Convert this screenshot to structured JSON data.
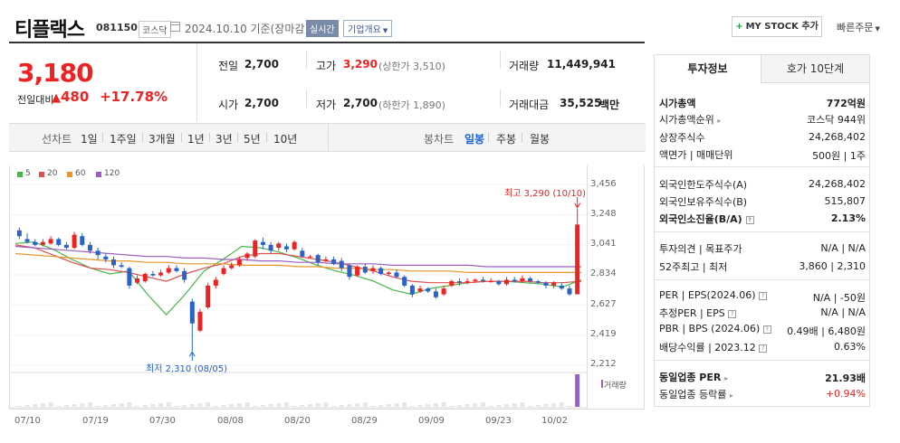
{
  "header": {
    "company_name": "티플랙스",
    "stock_code": "081150",
    "market": "코스닥",
    "date_text": "2024.10.10 기준(장마감)",
    "realtime_label": "실시간",
    "company_overview_label": "기업개요",
    "mystock_label": "MY STOCK 추가",
    "quick_order_label": "빠른주문"
  },
  "price": {
    "current": "3,180",
    "prev_label": "전일대비",
    "change": "480",
    "change_rate": "+17.78%"
  },
  "quote": {
    "prev_close_label": "전일",
    "prev_close": "2,700",
    "high_label": "고가",
    "high": "3,290",
    "upper_limit": "(상한가 3,510)",
    "volume_label": "거래량",
    "volume": "11,449,941",
    "open_label": "시가",
    "open": "2,700",
    "low_label": "저가",
    "low": "2,700",
    "lower_limit": "(하한가 1,890)",
    "amount_label": "거래대금",
    "amount": "35,525",
    "amount_unit": "백만"
  },
  "period_bar": {
    "line_chart_label": "선차트",
    "line_periods": [
      "1일",
      "1주일",
      "3개월",
      "1년",
      "3년",
      "5년",
      "10년"
    ],
    "candle_label": "봉차트",
    "candle_periods": [
      "일봉",
      "주봉",
      "월봉"
    ],
    "active_candle": "일봉"
  },
  "chart_data": {
    "type": "candlestick",
    "legend": [
      {
        "name": "5",
        "color": "#44b744"
      },
      {
        "name": "20",
        "color": "#e05050"
      },
      {
        "name": "60",
        "color": "#e8962a"
      },
      {
        "name": "120",
        "color": "#9a5fc2"
      }
    ],
    "yticks": [
      "3,456",
      "3,248",
      "3,041",
      "2,834",
      "2,627",
      "2,419",
      "2,212"
    ],
    "ylim": [
      2212,
      3456
    ],
    "xticks": [
      "07/10",
      "07/19",
      "07/30",
      "08/08",
      "08/20",
      "08/29",
      "09/09",
      "09/23",
      "10/02"
    ],
    "max_label": "최고 3,290 (10/10)",
    "min_label": "최저 2,310 (08/05)",
    "volume_label": "거래량",
    "candles": [
      {
        "o": 3140,
        "c": 3100,
        "h": 3160,
        "l": 3080
      },
      {
        "o": 3080,
        "c": 3060,
        "h": 3120,
        "l": 3050
      },
      {
        "o": 3060,
        "c": 3040,
        "h": 3080,
        "l": 3030
      },
      {
        "o": 3040,
        "c": 3060,
        "h": 3080,
        "l": 3030
      },
      {
        "o": 3050,
        "c": 3080,
        "h": 3100,
        "l": 3040
      },
      {
        "o": 3080,
        "c": 3040,
        "h": 3090,
        "l": 3030
      },
      {
        "o": 3040,
        "c": 3020,
        "h": 3060,
        "l": 3010
      },
      {
        "o": 3020,
        "c": 3110,
        "h": 3130,
        "l": 3010
      },
      {
        "o": 3100,
        "c": 3040,
        "h": 3120,
        "l": 3030
      },
      {
        "o": 3040,
        "c": 3000,
        "h": 3060,
        "l": 2980
      },
      {
        "o": 3000,
        "c": 2970,
        "h": 3020,
        "l": 2940
      },
      {
        "o": 2960,
        "c": 2940,
        "h": 2980,
        "l": 2920
      },
      {
        "o": 2940,
        "c": 2900,
        "h": 2960,
        "l": 2880
      },
      {
        "o": 2900,
        "c": 2890,
        "h": 2920,
        "l": 2880
      },
      {
        "o": 2880,
        "c": 2760,
        "h": 2890,
        "l": 2740
      },
      {
        "o": 2780,
        "c": 2810,
        "h": 2830,
        "l": 2770
      },
      {
        "o": 2790,
        "c": 2840,
        "h": 2850,
        "l": 2780
      },
      {
        "o": 2840,
        "c": 2830,
        "h": 2860,
        "l": 2820
      },
      {
        "o": 2830,
        "c": 2850,
        "h": 2870,
        "l": 2820
      },
      {
        "o": 2850,
        "c": 2880,
        "h": 2900,
        "l": 2840
      },
      {
        "o": 2880,
        "c": 2860,
        "h": 2900,
        "l": 2850
      },
      {
        "o": 2860,
        "c": 2800,
        "h": 2880,
        "l": 2780
      },
      {
        "o": 2650,
        "c": 2500,
        "h": 2670,
        "l": 2310
      },
      {
        "o": 2450,
        "c": 2580,
        "h": 2600,
        "l": 2440
      },
      {
        "o": 2610,
        "c": 2760,
        "h": 2780,
        "l": 2600
      },
      {
        "o": 2760,
        "c": 2800,
        "h": 2820,
        "l": 2740
      },
      {
        "o": 2840,
        "c": 2880,
        "h": 2900,
        "l": 2830
      },
      {
        "o": 2880,
        "c": 2900,
        "h": 2920,
        "l": 2870
      },
      {
        "o": 2900,
        "c": 2940,
        "h": 2960,
        "l": 2890
      },
      {
        "o": 2950,
        "c": 2980,
        "h": 2990,
        "l": 2930
      },
      {
        "o": 2960,
        "c": 3070,
        "h": 3080,
        "l": 2950
      },
      {
        "o": 3060,
        "c": 3040,
        "h": 3090,
        "l": 3010
      },
      {
        "o": 3040,
        "c": 3000,
        "h": 3060,
        "l": 2980
      },
      {
        "o": 3020,
        "c": 3050,
        "h": 3060,
        "l": 3000
      },
      {
        "o": 3030,
        "c": 3010,
        "h": 3050,
        "l": 2990
      },
      {
        "o": 3010,
        "c": 3060,
        "h": 3070,
        "l": 3000
      },
      {
        "o": 3000,
        "c": 2960,
        "h": 3020,
        "l": 2950
      },
      {
        "o": 2960,
        "c": 2960,
        "h": 2970,
        "l": 2950
      },
      {
        "o": 2970,
        "c": 2920,
        "h": 2980,
        "l": 2900
      },
      {
        "o": 2930,
        "c": 2940,
        "h": 2960,
        "l": 2920
      },
      {
        "o": 2940,
        "c": 2910,
        "h": 2960,
        "l": 2900
      },
      {
        "o": 2930,
        "c": 2880,
        "h": 2950,
        "l": 2860
      },
      {
        "o": 2900,
        "c": 2820,
        "h": 2910,
        "l": 2800
      },
      {
        "o": 2830,
        "c": 2890,
        "h": 2900,
        "l": 2820
      },
      {
        "o": 2890,
        "c": 2850,
        "h": 2910,
        "l": 2840
      },
      {
        "o": 2860,
        "c": 2880,
        "h": 2900,
        "l": 2840
      },
      {
        "o": 2880,
        "c": 2840,
        "h": 2890,
        "l": 2830
      },
      {
        "o": 2840,
        "c": 2850,
        "h": 2860,
        "l": 2830
      },
      {
        "o": 2850,
        "c": 2820,
        "h": 2870,
        "l": 2810
      },
      {
        "o": 2820,
        "c": 2760,
        "h": 2830,
        "l": 2750
      },
      {
        "o": 2760,
        "c": 2700,
        "h": 2770,
        "l": 2680
      },
      {
        "o": 2720,
        "c": 2740,
        "h": 2760,
        "l": 2710
      },
      {
        "o": 2740,
        "c": 2720,
        "h": 2750,
        "l": 2710
      },
      {
        "o": 2720,
        "c": 2680,
        "h": 2740,
        "l": 2670
      },
      {
        "o": 2700,
        "c": 2740,
        "h": 2760,
        "l": 2690
      },
      {
        "o": 2760,
        "c": 2790,
        "h": 2800,
        "l": 2750
      },
      {
        "o": 2790,
        "c": 2780,
        "h": 2810,
        "l": 2760
      },
      {
        "o": 2780,
        "c": 2790,
        "h": 2810,
        "l": 2770
      },
      {
        "o": 2790,
        "c": 2800,
        "h": 2810,
        "l": 2780
      },
      {
        "o": 2800,
        "c": 2790,
        "h": 2820,
        "l": 2780
      },
      {
        "o": 2790,
        "c": 2790,
        "h": 2810,
        "l": 2780
      },
      {
        "o": 2790,
        "c": 2770,
        "h": 2800,
        "l": 2760
      },
      {
        "o": 2770,
        "c": 2800,
        "h": 2820,
        "l": 2760
      },
      {
        "o": 2800,
        "c": 2790,
        "h": 2820,
        "l": 2780
      },
      {
        "o": 2790,
        "c": 2810,
        "h": 2830,
        "l": 2780
      },
      {
        "o": 2810,
        "c": 2790,
        "h": 2820,
        "l": 2780
      },
      {
        "o": 2790,
        "c": 2780,
        "h": 2800,
        "l": 2770
      },
      {
        "o": 2780,
        "c": 2760,
        "h": 2790,
        "l": 2740
      },
      {
        "o": 2760,
        "c": 2780,
        "h": 2790,
        "l": 2740
      },
      {
        "o": 2760,
        "c": 2740,
        "h": 2780,
        "l": 2730
      },
      {
        "o": 2740,
        "c": 2700,
        "h": 2760,
        "l": 2690
      },
      {
        "o": 2700,
        "c": 3180,
        "h": 3290,
        "l": 2700
      }
    ],
    "ma_values": {
      "5": {
        "start": 3060,
        "path": [
          3050,
          3060,
          3010,
          2940,
          2880,
          2840,
          2860,
          2700,
          2560,
          2700,
          2860,
          2940,
          3030,
          3020,
          2990,
          2950,
          2900,
          2860,
          2830,
          2790,
          2730,
          2700,
          2740,
          2760,
          2780,
          2790,
          2790,
          2780,
          2770,
          2750,
          2800
        ]
      },
      "20": {
        "start": 3040,
        "path": [
          3040,
          3020,
          2970,
          2920,
          2880,
          2870,
          2850,
          2820,
          2790,
          2840,
          2880,
          2910,
          2960,
          2980,
          2980,
          2960,
          2940,
          2920,
          2890,
          2860,
          2820,
          2790,
          2780,
          2780,
          2780,
          2790,
          2790,
          2790,
          2780,
          2780,
          2790
        ]
      },
      "60": {
        "start": 2980,
        "path": [
          2980,
          2970,
          2960,
          2950,
          2940,
          2930,
          2930,
          2920,
          2920,
          2910,
          2910,
          2910,
          2900,
          2900,
          2900,
          2890,
          2890,
          2880,
          2880,
          2870,
          2870,
          2860,
          2860,
          2860,
          2850,
          2850,
          2850,
          2850,
          2850,
          2850,
          2850
        ]
      },
      "120": {
        "start": 3030,
        "path": [
          3030,
          3020,
          3010,
          3000,
          2990,
          2980,
          2970,
          2960,
          2960,
          2950,
          2950,
          2940,
          2940,
          2930,
          2930,
          2920,
          2920,
          2910,
          2910,
          2910,
          2900,
          2900,
          2900,
          2900,
          2900,
          2890,
          2890,
          2890,
          2890,
          2890,
          2890
        ]
      }
    }
  },
  "right_panel": {
    "tab_investment": "투자정보",
    "tab_orderbook": "호가 10단계",
    "market_cap_label": "시가총액",
    "market_cap": "772억원",
    "market_cap_rank_label": "시가총액순위",
    "market_cap_rank": "코스닥 944위",
    "listed_shares_label": "상장주식수",
    "listed_shares": "24,268,402",
    "par_label": "액면가 | 매매단위",
    "par_value": "500원 | 1주",
    "foreign_limit_label": "외국인한도주식수(A)",
    "foreign_limit": "24,268,402",
    "foreign_hold_label": "외국인보유주식수(B)",
    "foreign_hold": "515,807",
    "foreign_rate_label": "외국인소진율(B/A)",
    "foreign_rate": "2.13%",
    "opinion_label": "투자의견 | 목표주가",
    "opinion": "N/A | N/A",
    "week52_label": "52주최고 | 최저",
    "week52": "3,860 | 2,310",
    "per_label": "PER | EPS(2024.06)",
    "per": "N/A | -50원",
    "est_per_label": "추정PER | EPS",
    "est_per": "N/A | N/A",
    "pbr_label": "PBR | BPS (2024.06)",
    "pbr": "0.49배 | 6,480원",
    "dividend_label": "배당수익률 | 2023.12",
    "dividend": "0.63%",
    "industry_per_label": "동일업종 PER",
    "industry_per": "21.93배",
    "industry_rate_label": "동일업종 등락률",
    "industry_rate": "+0.94%"
  }
}
